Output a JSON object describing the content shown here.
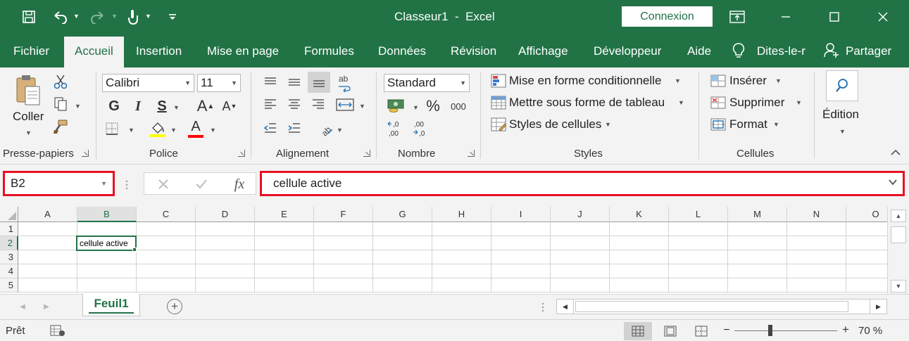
{
  "titlebar": {
    "title": "Classeur1  -  Excel",
    "connexion_label": "Connexion",
    "qat": [
      "save-icon",
      "undo-icon",
      "redo-icon",
      "touch-mode-icon",
      "customize-qat-icon"
    ],
    "window_buttons": [
      "ribbon-display-icon",
      "minimize-icon",
      "maximize-icon",
      "close-icon"
    ]
  },
  "tabs": {
    "fichier": "Fichier",
    "accueil": "Accueil",
    "insertion": "Insertion",
    "mise_en_page": "Mise en page",
    "formules": "Formules",
    "donnees": "Données",
    "revision": "Révision",
    "affichage": "Affichage",
    "developpeur": "Développeur",
    "aide": "Aide",
    "dites_le": "Dites-le-r",
    "partager": "Partager"
  },
  "ribbon": {
    "clipboard": {
      "label": "Presse-papiers",
      "coller": "Coller"
    },
    "font": {
      "label": "Police",
      "font_name": "Calibri",
      "font_size": "11",
      "bold": "G",
      "italic": "I",
      "underline": "S",
      "grow": "A",
      "shrink": "A",
      "color_letter": "A",
      "fill_color": "#ffff00",
      "font_color": "#ff0000"
    },
    "alignment": {
      "label": "Alignement"
    },
    "number": {
      "label": "Nombre",
      "format": "Standard",
      "percent": "%",
      "thousands": "000",
      "dec_inc": "←,0\n,00",
      "dec_dec": ",00\n→,0"
    },
    "styles": {
      "label": "Styles",
      "conditional": "Mise en forme conditionnelle",
      "table": "Mettre sous forme de tableau",
      "cell_styles": "Styles de cellules"
    },
    "cells": {
      "label": "Cellules",
      "insert": "Insérer",
      "delete": "Supprimer",
      "format": "Format"
    },
    "editing": {
      "label": "Édition"
    }
  },
  "formula_bar": {
    "name_box": "B2",
    "formula": "cellule active",
    "fx": "fx"
  },
  "grid": {
    "columns": [
      "A",
      "B",
      "C",
      "D",
      "E",
      "F",
      "G",
      "H",
      "I",
      "J",
      "K",
      "L",
      "M",
      "N",
      "O"
    ],
    "rows": [
      "1",
      "2",
      "3",
      "4",
      "5"
    ],
    "active_column": "B",
    "active_row": "2",
    "active_cell_value": "cellule active"
  },
  "sheets": {
    "tabs": [
      "Feuil1"
    ],
    "add_label": "+"
  },
  "status": {
    "text": "Prêt",
    "zoom": "70 %",
    "zoom_percent": 70
  },
  "colors": {
    "brand": "#217346",
    "highlight_border": "#e81123"
  }
}
